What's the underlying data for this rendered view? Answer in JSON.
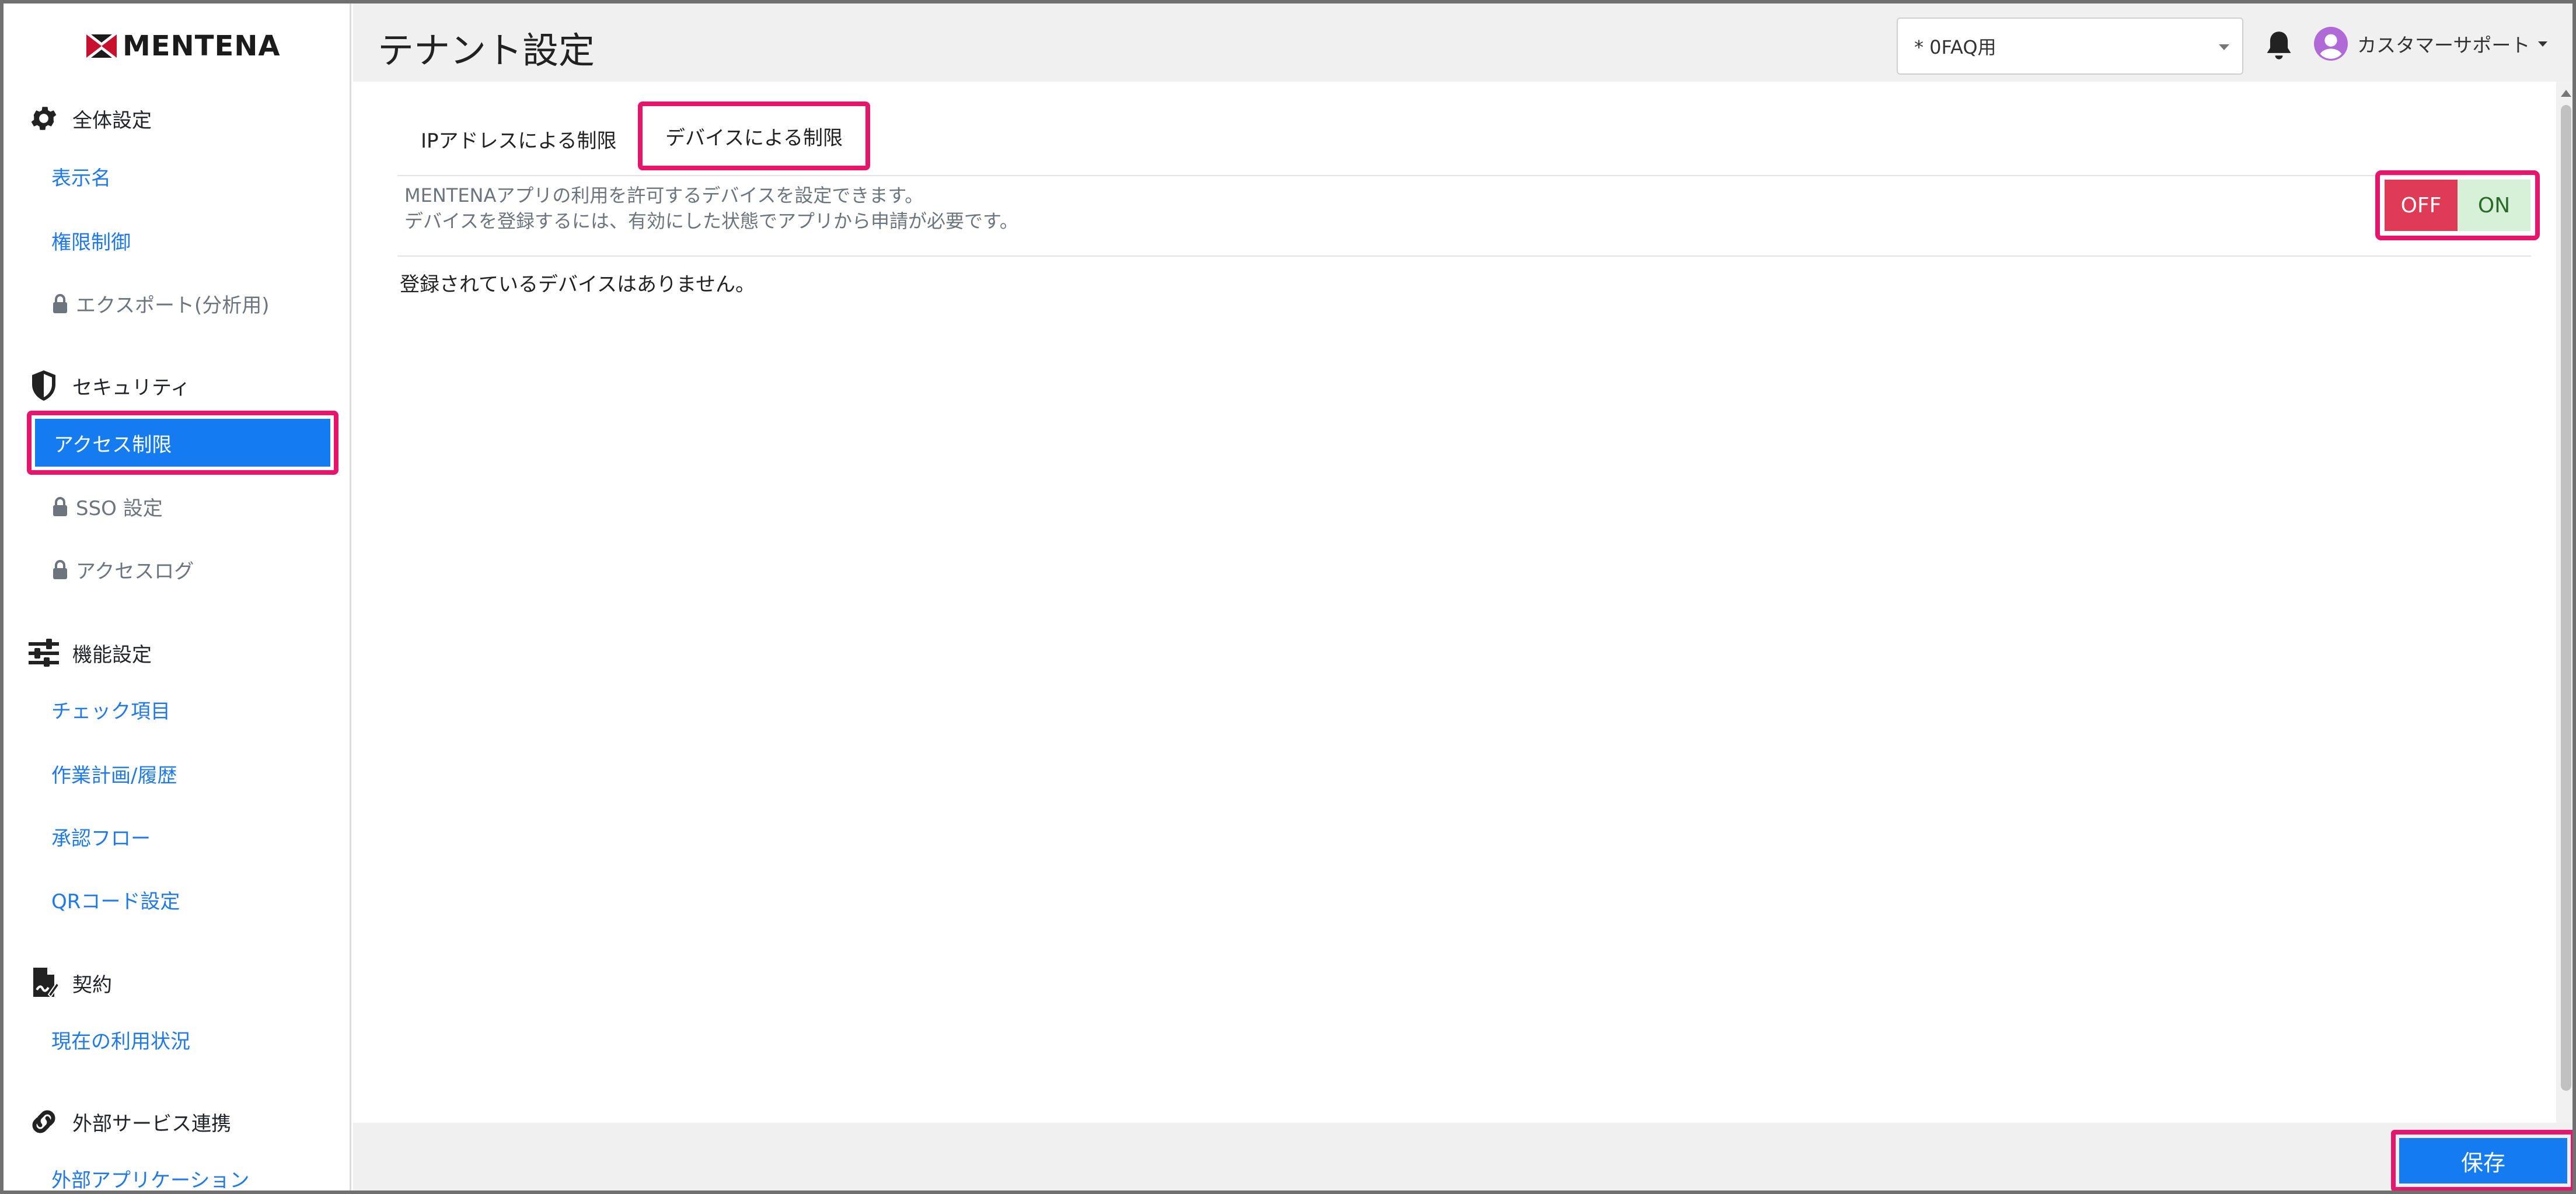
{
  "logo": {
    "text": "MENTENA"
  },
  "header": {
    "title": "テナント設定",
    "tenant_select_value": "* 0FAQ用",
    "user_name": "カスタマーサポート"
  },
  "sidebar": {
    "sections": [
      {
        "title": "全体設定",
        "icon": "gear-icon"
      },
      {
        "title": "セキュリティ",
        "icon": "shield-icon"
      },
      {
        "title": "機能設定",
        "icon": "sliders-icon"
      },
      {
        "title": "契約",
        "icon": "contract-icon"
      },
      {
        "title": "外部サービス連携",
        "icon": "link-icon"
      }
    ],
    "items": {
      "display_name": "表示名",
      "permission": "権限制御",
      "export": "エクスポート(分析用)",
      "access_control": "アクセス制限",
      "sso": "SSO 設定",
      "access_log": "アクセスログ",
      "check_items": "チェック項目",
      "work_plan": "作業計画/履歴",
      "approval_flow": "承認フロー",
      "qr_code": "QRコード設定",
      "usage": "現在の利用状況",
      "external_app": "外部アプリケーション"
    }
  },
  "tabs": {
    "ip": "IPアドレスによる制限",
    "device": "デバイスによる制限"
  },
  "content": {
    "desc_line1": "MENTENAアプリの利用を許可するデバイスを設定できます。",
    "desc_line2": "デバイスを登録するには、有効にした状態でアプリから申請が必要です。",
    "empty_message": "登録されているデバイスはありません。",
    "toggle_off": "OFF",
    "toggle_on": "ON",
    "toggle_state": "ON"
  },
  "footer": {
    "save_label": "保存"
  },
  "colors": {
    "accent": "#147bf0",
    "highlight": "#e5166c",
    "link": "#1f7ae8",
    "toggle_off": "#df3a56",
    "toggle_on": "#d7f0d8"
  }
}
